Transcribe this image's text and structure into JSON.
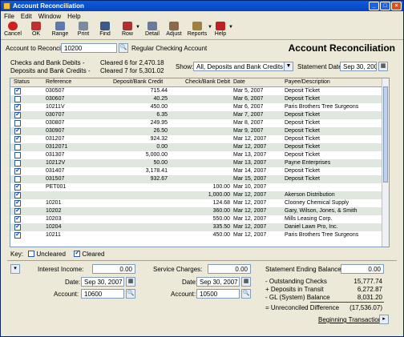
{
  "window": {
    "title": "Account Reconciliation"
  },
  "menu": [
    "File",
    "Edit",
    "Window",
    "Help"
  ],
  "toolbar": [
    {
      "label": "Cancel",
      "icon": "cancel-icon"
    },
    {
      "label": "OK",
      "icon": "ok-icon"
    },
    {
      "label": "Range",
      "icon": "range-icon"
    },
    {
      "label": "Print",
      "icon": "print-icon"
    },
    {
      "label": "Find",
      "icon": "find-icon"
    },
    {
      "label": "Row",
      "icon": "row-icon"
    },
    {
      "label": "Detail",
      "icon": "detail-icon"
    },
    {
      "label": "Adjust",
      "icon": "adjust-icon"
    },
    {
      "label": "Reports",
      "icon": "reports-icon"
    },
    {
      "label": "Help",
      "icon": "help-icon"
    }
  ],
  "heading": "Account Reconciliation",
  "account": {
    "label": "Account to Reconcile:",
    "value": "10200",
    "name": "Regular Checking Account"
  },
  "summary": {
    "checks": "Checks and Bank Debits -",
    "checks_detail": "Cleared 6 for 2,470.18",
    "deposits": "Deposits and Bank Credits -",
    "deposits_detail": "Cleared 7 for 5,301.02"
  },
  "show": {
    "label": "Show:",
    "value": "All, Deposits and Bank Credits First"
  },
  "statement_date": {
    "label": "Statement Date:",
    "value": "Sep 30, 2007"
  },
  "grid": {
    "headers": [
      "Status",
      "Reference",
      "Deposit/Bank Credit",
      "Check/Bank Debit",
      "Date",
      "Payee/Description"
    ],
    "rows": [
      {
        "cleared": true,
        "ref": "030507",
        "deposit": "715.44",
        "check": "",
        "date": "Mar 5, 2007",
        "payee": "Deposit Ticket"
      },
      {
        "cleared": false,
        "ref": "030607",
        "deposit": "40.25",
        "check": "",
        "date": "Mar 6, 2007",
        "payee": "Deposit Ticket"
      },
      {
        "cleared": true,
        "ref": "10211V",
        "deposit": "450.00",
        "check": "",
        "date": "Mar 6, 2007",
        "payee": "Paris Brothers Tree Surgeons"
      },
      {
        "cleared": true,
        "ref": "030707",
        "deposit": "6.35",
        "check": "",
        "date": "Mar 7, 2007",
        "payee": "Deposit Ticket"
      },
      {
        "cleared": false,
        "ref": "030807",
        "deposit": "249.95",
        "check": "",
        "date": "Mar 8, 2007",
        "payee": "Deposit Ticket"
      },
      {
        "cleared": true,
        "ref": "030907",
        "deposit": "26.50",
        "check": "",
        "date": "Mar 9, 2007",
        "payee": "Deposit Ticket"
      },
      {
        "cleared": true,
        "ref": "031207",
        "deposit": "924.32",
        "check": "",
        "date": "Mar 12, 2007",
        "payee": "Deposit Ticket"
      },
      {
        "cleared": false,
        "ref": "0312071",
        "deposit": "0.00",
        "check": "",
        "date": "Mar 12, 2007",
        "payee": "Deposit Ticket"
      },
      {
        "cleared": false,
        "ref": "031307",
        "deposit": "5,000.00",
        "check": "",
        "date": "Mar 13, 2007",
        "payee": "Deposit Ticket"
      },
      {
        "cleared": false,
        "ref": "10212V",
        "deposit": "50.00",
        "check": "",
        "date": "Mar 13, 2007",
        "payee": "Payne Enterprises"
      },
      {
        "cleared": true,
        "ref": "031407",
        "deposit": "3,178.41",
        "check": "",
        "date": "Mar 14, 2007",
        "payee": "Deposit Ticket"
      },
      {
        "cleared": false,
        "ref": "031507",
        "deposit": "932.67",
        "check": "",
        "date": "Mar 15, 2007",
        "payee": "Deposit Ticket"
      },
      {
        "cleared": true,
        "ref": "PET001",
        "deposit": "",
        "check": "100.00",
        "date": "Mar 10, 2007",
        "payee": ""
      },
      {
        "cleared": true,
        "ref": "",
        "deposit": "",
        "check": "1,000.00",
        "date": "Mar 12, 2007",
        "payee": "Akerson Distribution"
      },
      {
        "cleared": true,
        "ref": "10201",
        "deposit": "",
        "check": "124.68",
        "date": "Mar 12, 2007",
        "payee": "Clooney Chemical Supply"
      },
      {
        "cleared": true,
        "ref": "10202",
        "deposit": "",
        "check": "360.00",
        "date": "Mar 12, 2007",
        "payee": "Gary, Wilson, Jones, & Smith"
      },
      {
        "cleared": true,
        "ref": "10203",
        "deposit": "",
        "check": "550.00",
        "date": "Mar 12, 2007",
        "payee": "Mills Leasing Corp."
      },
      {
        "cleared": true,
        "ref": "10204",
        "deposit": "",
        "check": "335.50",
        "date": "Mar 12, 2007",
        "payee": "Daniel Lawn Pro, Inc."
      },
      {
        "cleared": true,
        "ref": "10211",
        "deposit": "",
        "check": "450.00",
        "date": "Mar 12, 2007",
        "payee": "Paris Brothers Tree Surgeons"
      }
    ]
  },
  "key": {
    "label": "Key:",
    "uncleared": "Uncleared",
    "cleared": "Cleared"
  },
  "interest": {
    "label": "Interest Income:",
    "value": "0.00",
    "date_label": "Date:",
    "date": "Sep 30, 2007",
    "account_label": "Account:",
    "account": "10600"
  },
  "service": {
    "label": "Service Charges:",
    "value": "0.00",
    "date_label": "Date:",
    "date": "Sep 30, 2007",
    "account_label": "Account:",
    "account": "10500"
  },
  "balance": {
    "ending_label": "Statement Ending Balance:",
    "ending": "0.00",
    "outstanding_label": "- Outstanding Checks",
    "outstanding": "15,777.74",
    "deposits_label": "+ Deposits in Transit",
    "deposits": "6,272.87",
    "gl_label": "- GL (System) Balance",
    "gl": "8,031.20",
    "unrec_label": "= Unreconciled Difference",
    "unrec": "(17,536.07)",
    "beginning_label": "Beginning Transactions:"
  },
  "colors": {
    "title_bar": "#0844b8",
    "alt_row": "#dfe7df",
    "check_blue": "#1a3fb0"
  }
}
